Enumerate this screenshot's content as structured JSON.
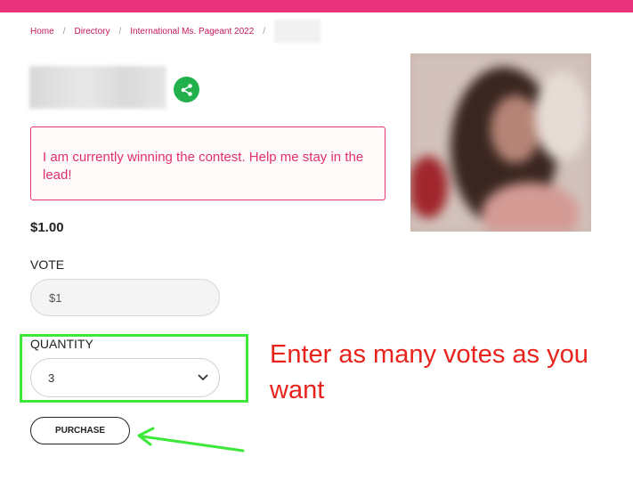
{
  "breadcrumb": {
    "items": [
      "Home",
      "Directory",
      "International Ms. Pageant 2022"
    ],
    "separator": "/"
  },
  "contest": {
    "lead_message": "I am currently winning the contest. Help me stay in the lead!"
  },
  "vote_form": {
    "price": "$1.00",
    "vote_label": "VOTE",
    "vote_value": "$1",
    "quantity_label": "QUANTITY",
    "quantity_value": "3",
    "purchase_label": "PURCHASE"
  },
  "annotation": {
    "text": "Enter as many votes as you want",
    "color": "#e8231c",
    "highlight_color": "#3ee83a"
  },
  "colors": {
    "brand": "#e8327a",
    "share": "#21b04b"
  },
  "icons": [
    "share-icon",
    "chevron-down-icon"
  ]
}
